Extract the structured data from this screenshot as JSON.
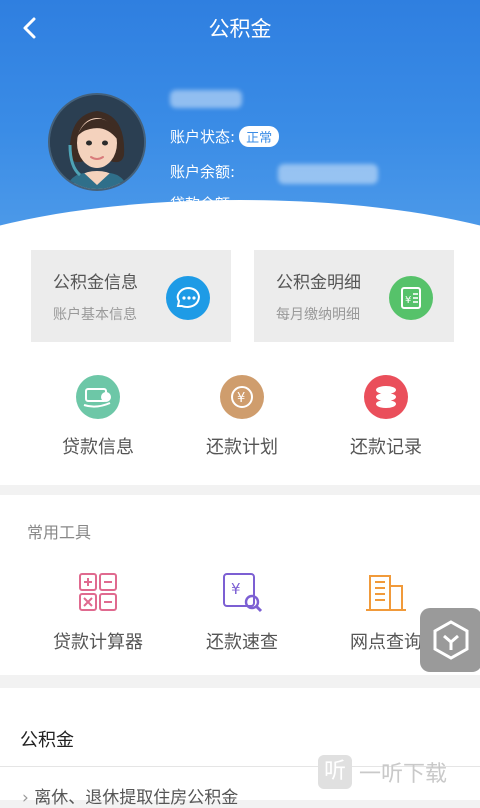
{
  "header": {
    "title": "公积金",
    "status_label": "账户状态:",
    "status_value": "正常",
    "balance_label": "账户余额:",
    "loan_label": "贷款余额:",
    "loan_value": "-"
  },
  "cards": [
    {
      "title": "公积金信息",
      "subtitle": "账户基本信息",
      "color": "#1e9be6"
    },
    {
      "title": "公积金明细",
      "subtitle": "每月缴纳明细",
      "color": "#56c26a"
    }
  ],
  "quick_actions": [
    {
      "label": "贷款信息",
      "color": "#6dc7a7",
      "icon": "money-transfer-icon"
    },
    {
      "label": "还款计划",
      "color": "#cf9d6d",
      "icon": "yen-clock-icon"
    },
    {
      "label": "还款记录",
      "color": "#ea4f5b",
      "icon": "coins-icon"
    }
  ],
  "tools": {
    "section_title": "常用工具",
    "items": [
      {
        "label": "贷款计算器",
        "color": "#e06a8f",
        "icon": "calculator-icon"
      },
      {
        "label": "还款速查",
        "color": "#7c5fd3",
        "icon": "yen-search-icon"
      },
      {
        "label": "网点查询",
        "color": "#f19a3a",
        "icon": "building-icon"
      }
    ]
  },
  "bottom": {
    "section_title": "公积金",
    "list": [
      "离休、退休提取住房公积金"
    ]
  },
  "watermark": "一听下载"
}
